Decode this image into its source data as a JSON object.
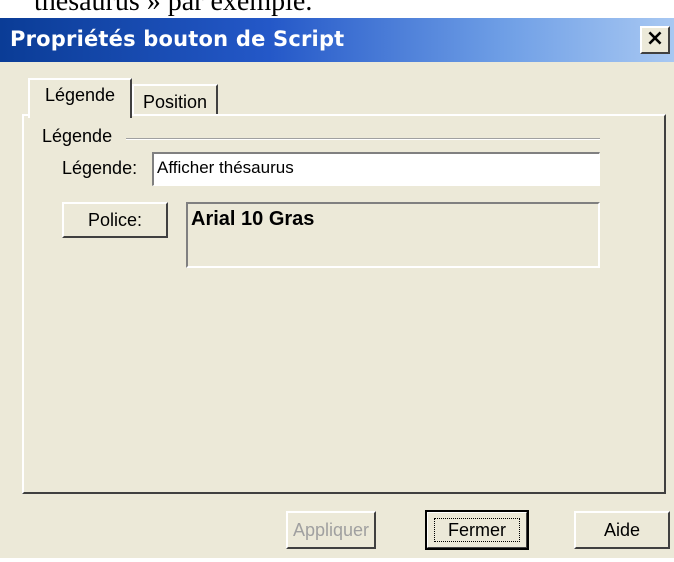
{
  "document": {
    "snippet": "thésaurus » par exemple."
  },
  "dialog": {
    "title": "Propriétés bouton de Script",
    "close_glyph": "×"
  },
  "tabs": [
    {
      "label": "Légende",
      "active": true
    },
    {
      "label": "Position",
      "active": false
    }
  ],
  "legend_group": {
    "title": "Légende",
    "field_label": "Légende:",
    "field_value": "Afficher thésaurus",
    "font_button_label": "Police:",
    "font_preview": "Arial 10 Gras"
  },
  "buttons": {
    "apply": {
      "label": "Appliquer",
      "enabled": false
    },
    "close": {
      "label": "Fermer",
      "default": true
    },
    "help": {
      "label": "Aide"
    }
  },
  "colors": {
    "titlebar_start": "#0a3c96",
    "titlebar_end": "#a8c8f2",
    "dialog_bg": "#ece9d8"
  }
}
